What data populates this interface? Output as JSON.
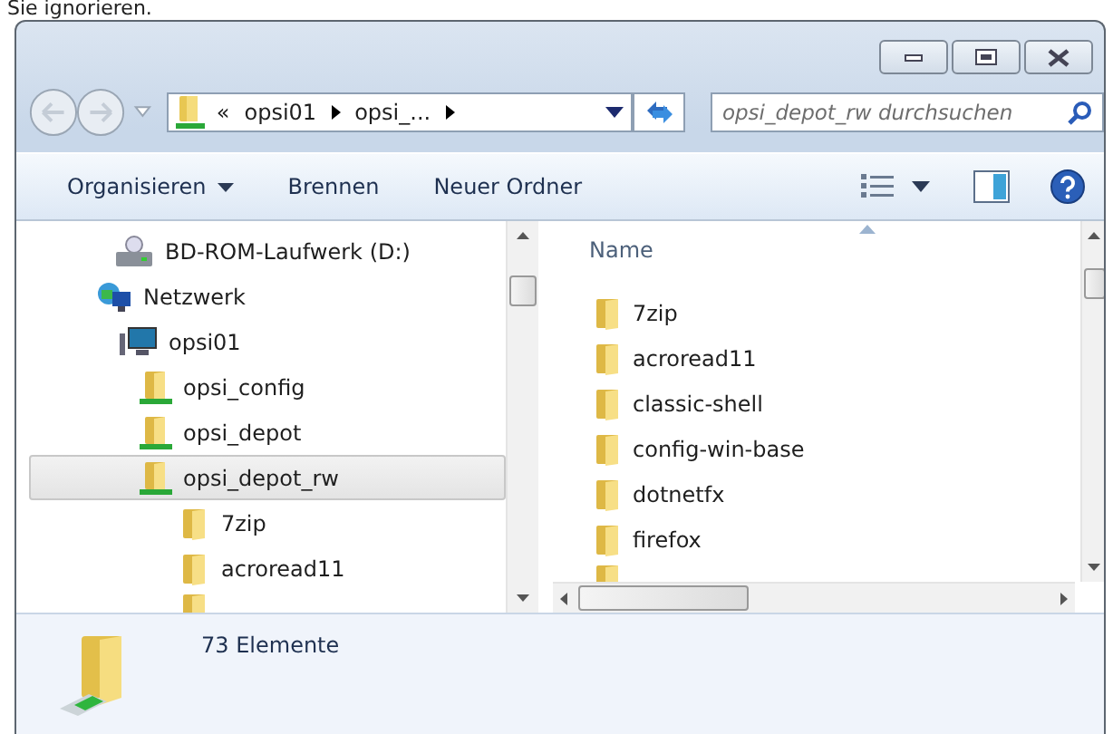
{
  "caption": "Sie ignorieren.",
  "address_bar": {
    "overflow": "«",
    "segments": [
      "opsi01",
      "opsi_..."
    ]
  },
  "search": {
    "placeholder": "opsi_depot_rw durchsuchen"
  },
  "toolbar": {
    "items": [
      {
        "label": "Organisieren",
        "kind": "menu"
      },
      {
        "label": "Brennen",
        "kind": "button"
      },
      {
        "label": "Neuer Ordner",
        "kind": "button"
      }
    ]
  },
  "navigation_pane": {
    "items": [
      {
        "label": "BD-ROM-Laufwerk (D:)",
        "kind": "drive",
        "selected": false
      },
      {
        "label": "Netzwerk",
        "kind": "network",
        "selected": false,
        "children": [
          {
            "label": "opsi01",
            "kind": "computer",
            "selected": false,
            "children": [
              {
                "label": "opsi_config",
                "kind": "share",
                "selected": false
              },
              {
                "label": "opsi_depot",
                "kind": "share",
                "selected": false
              },
              {
                "label": "opsi_depot_rw",
                "kind": "share",
                "selected": true,
                "children": [
                  {
                    "label": "7zip",
                    "kind": "folder",
                    "selected": false
                  },
                  {
                    "label": "acroread11",
                    "kind": "folder",
                    "selected": false
                  }
                ]
              }
            ]
          }
        ]
      }
    ]
  },
  "file_list": {
    "columns": [
      "Name"
    ],
    "items": [
      {
        "name": "7zip",
        "selected": false
      },
      {
        "name": "acroread11",
        "selected": false
      },
      {
        "name": "classic-shell",
        "selected": false
      },
      {
        "name": "config-win-base",
        "selected": false
      },
      {
        "name": "dotnetfx",
        "selected": false
      },
      {
        "name": "firefox",
        "selected": false
      }
    ]
  },
  "status_bar": {
    "count": "73 Elemente"
  }
}
